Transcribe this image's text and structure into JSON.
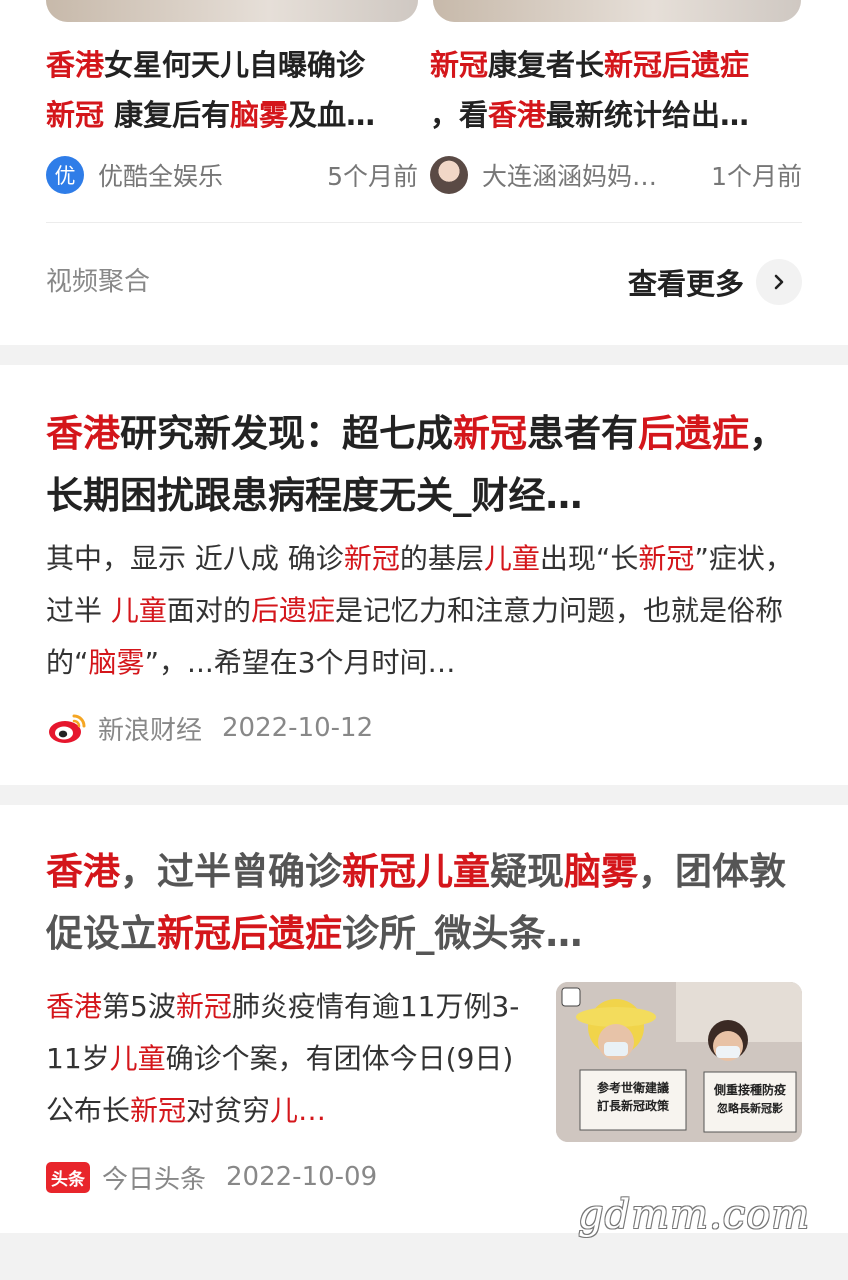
{
  "video_section": {
    "videos": [
      {
        "title_line1": [
          {
            "text": "香港",
            "hl": true
          },
          {
            "text": "女星何天儿自曝确诊",
            "hl": false
          }
        ],
        "title_line2": [
          {
            "text": "新冠",
            "hl": true
          },
          {
            "text": " 康复后有",
            "hl": false
          },
          {
            "text": "脑雾",
            "hl": true
          },
          {
            "text": "及血…",
            "hl": false
          }
        ],
        "source_badge": "优",
        "source": "优酷全娱乐",
        "time": "5个月前"
      },
      {
        "title_line1": [
          {
            "text": "新冠",
            "hl": true
          },
          {
            "text": "康复者长",
            "hl": false
          },
          {
            "text": "新冠后遗症",
            "hl": true
          }
        ],
        "title_line2": [
          {
            "text": "，看",
            "hl": false
          },
          {
            "text": "香港",
            "hl": true
          },
          {
            "text": "最新统计给出…",
            "hl": false
          }
        ],
        "source": "大连涵涵妈妈…",
        "time": "1个月前"
      }
    ],
    "label": "视频聚合",
    "more_label": "查看更多",
    "more_icon": "chevron-right-icon"
  },
  "article1": {
    "title": [
      {
        "text": "香港",
        "hl": true
      },
      {
        "text": "研究新发现：超七成",
        "hl": false
      },
      {
        "text": "新冠",
        "hl": true
      },
      {
        "text": "患者有",
        "hl": false
      },
      {
        "text": "后遗症",
        "hl": true
      },
      {
        "text": "，长期困扰跟患病程度无关_财经…",
        "hl": false
      }
    ],
    "summary": [
      {
        "text": "其中，显示 近八成 确诊",
        "hl": false
      },
      {
        "text": "新冠",
        "hl": true
      },
      {
        "text": "的基层",
        "hl": false
      },
      {
        "text": "儿童",
        "hl": true
      },
      {
        "text": "出现“长",
        "hl": false
      },
      {
        "text": "新冠",
        "hl": true
      },
      {
        "text": "”症状，过半 ",
        "hl": false
      },
      {
        "text": "儿童",
        "hl": true
      },
      {
        "text": "面对的",
        "hl": false
      },
      {
        "text": "后遗症",
        "hl": true
      },
      {
        "text": "是记忆力和注意力问题，也就是俗称的“",
        "hl": false
      },
      {
        "text": "脑雾",
        "hl": true
      },
      {
        "text": "”，...希望在3个月时间…",
        "hl": false
      }
    ],
    "source": "新浪财经",
    "date": "2022-10-12"
  },
  "article2": {
    "title": [
      {
        "text": "香港",
        "hl": true
      },
      {
        "text": "，过半曾确诊",
        "hl": false
      },
      {
        "text": "新冠儿童",
        "hl": true
      },
      {
        "text": "疑现",
        "hl": false
      },
      {
        "text": "脑雾",
        "hl": true
      },
      {
        "text": "，团体敦促设立",
        "hl": false
      },
      {
        "text": "新冠后遗症",
        "hl": true
      },
      {
        "text": "诊所_微头条…",
        "hl": false
      }
    ],
    "summary": [
      {
        "text": "香港",
        "hl": true
      },
      {
        "text": "第5波",
        "hl": false
      },
      {
        "text": "新冠",
        "hl": true
      },
      {
        "text": "肺炎疫情有逾11万例3-11岁",
        "hl": false
      },
      {
        "text": "儿童",
        "hl": true
      },
      {
        "text": "确诊个案，有团体今日(9日)公布长",
        "hl": false
      },
      {
        "text": "新冠",
        "hl": true
      },
      {
        "text": "对贫穷",
        "hl": false
      },
      {
        "text": "儿…",
        "hl": true
      }
    ],
    "image_signs": [
      "参考世衛建議",
      "訂長新冠政策",
      "側重接種防疫",
      "忽略長新冠影"
    ],
    "source_badge": "头条",
    "source": "今日头条",
    "date": "2022-10-09"
  },
  "watermark": "gdmm.com",
  "colors": {
    "highlight": "#d4161b",
    "accent_blue": "#2f7de8",
    "toutiao_red": "#e8252b"
  }
}
